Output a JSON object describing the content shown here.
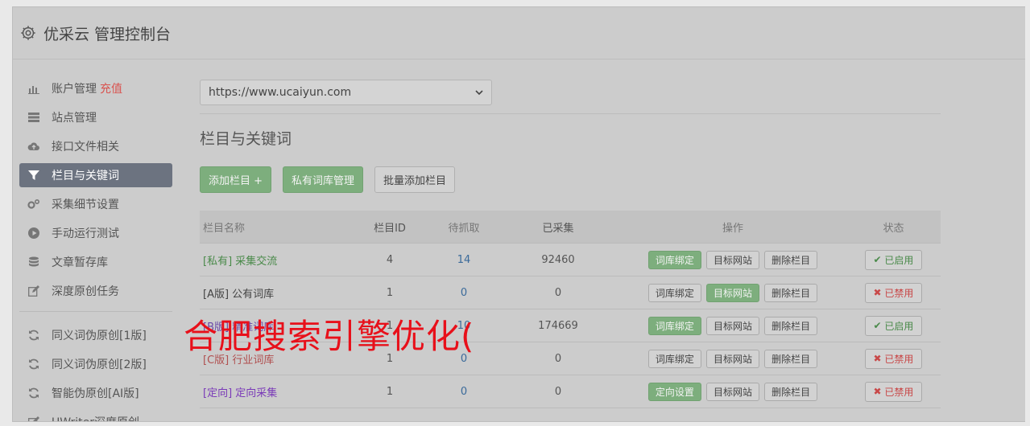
{
  "header": {
    "title": "优采云 管理控制台"
  },
  "sidebar": {
    "items": [
      {
        "label": "账户管理",
        "extra": "充值",
        "icon": "bar-chart-icon"
      },
      {
        "label": "站点管理",
        "icon": "server-icon"
      },
      {
        "label": "接口文件相关",
        "icon": "cloud-upload-icon"
      },
      {
        "label": "栏目与关键词",
        "icon": "filter-icon",
        "active": true
      },
      {
        "label": "采集细节设置",
        "icon": "cogs-icon"
      },
      {
        "label": "手动运行测试",
        "icon": "play-circle-icon"
      },
      {
        "label": "文章暂存库",
        "icon": "database-icon"
      },
      {
        "label": "深度原创任务",
        "icon": "edit-icon"
      },
      {
        "label": "同义词伪原创[1版]",
        "icon": "refresh-icon"
      },
      {
        "label": "同义词伪原创[2版]",
        "icon": "refresh-icon"
      },
      {
        "label": "智能伪原创[AI版]",
        "icon": "refresh-icon"
      },
      {
        "label": "UWriter深度原创",
        "icon": "edit-icon"
      }
    ]
  },
  "main": {
    "site_select": "https://www.ucaiyun.com",
    "section_title": "栏目与关键词",
    "buttons": {
      "add": "添加栏目 +",
      "private_lib": "私有词库管理",
      "batch_add": "批量添加栏目"
    },
    "table": {
      "headers": [
        "栏目名称",
        "栏目ID",
        "待抓取",
        "已采集",
        "操作",
        "状态"
      ],
      "rows": [
        {
          "name": "[私有] 采集交流",
          "id": "4",
          "pending": "14",
          "collected": "92460",
          "op1": "词库绑定",
          "op2": "目标网站",
          "op3": "删除栏目",
          "status": "已启用"
        },
        {
          "name": "[A版] 公有词库",
          "id": "1",
          "pending": "0",
          "collected": "0",
          "op1": "词库绑定",
          "op2": "目标网站",
          "op3": "删除栏目",
          "status": "已禁用"
        },
        {
          "name": "[B版] 精准词库",
          "id": "1",
          "pending": "10",
          "collected": "174669",
          "op1": "词库绑定",
          "op2": "目标网站",
          "op3": "删除栏目",
          "status": "已启用"
        },
        {
          "name": "[C版] 行业词库",
          "id": "1",
          "pending": "0",
          "collected": "0",
          "op1": "词库绑定",
          "op2": "目标网站",
          "op3": "删除栏目",
          "status": "已禁用"
        },
        {
          "name": "[定向] 定向采集",
          "id": "1",
          "pending": "0",
          "collected": "0",
          "op1": "定向设置",
          "op2": "目标网站",
          "op3": "删除栏目",
          "status": "已禁用"
        }
      ]
    }
  },
  "overlay_text": "合肥搜索引擎优化(",
  "colors": {
    "accent_green": "#7dae7d",
    "active_nav": "#6c7380",
    "overlay_red": "#e8101a",
    "danger": "#d9534f"
  }
}
